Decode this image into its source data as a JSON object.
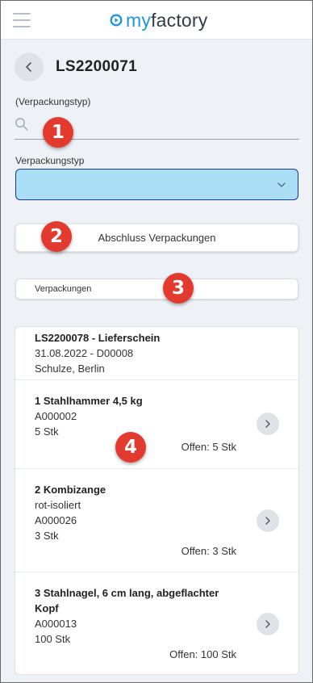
{
  "app": {
    "brand_my": "my",
    "brand_rest": "factory"
  },
  "header": {
    "document_title": "LS2200071"
  },
  "search": {
    "label": "(Verpackungstyp)",
    "value": "",
    "placeholder": ""
  },
  "packaging_type": {
    "label": "Verpackungstyp",
    "selected_value": ""
  },
  "actions": {
    "abschluss_label": "Abschluss Verpackungen",
    "verpackungen_label": "Verpackungen"
  },
  "delivery": {
    "title": "LS2200078 - Lieferschein",
    "date_line": "31.08.2022 - D00008",
    "customer": "Schulze, Berlin"
  },
  "items": [
    {
      "name": "1 Stahlhammer 4,5 kg",
      "detail": "",
      "article_no": "A000002",
      "quantity": "5 Stk",
      "open": "Offen: 5 Stk"
    },
    {
      "name": "2 Kombizange",
      "detail": "rot-isoliert",
      "article_no": "A000026",
      "quantity": "3 Stk",
      "open": "Offen: 3 Stk"
    },
    {
      "name_line1": "3 Stahlnagel, 6 cm lang, abgeflachter",
      "name_line2": "Kopf",
      "article_no": "A000013",
      "quantity": "100 Stk",
      "open": "Offen: 100 Stk"
    }
  ],
  "annotations": {
    "m1": "1",
    "m2": "2",
    "m3": "3",
    "m4": "4"
  },
  "colors": {
    "select_bg": "#a9def4",
    "select_border": "#173a9c",
    "marker": "#e23a2e",
    "brand_blue": "#1e97d6"
  },
  "icons": {
    "menu": "hamburger-icon",
    "logo": "play-circle-icon",
    "back": "chevron-left-icon",
    "search": "search-icon",
    "select": "chevron-down-icon",
    "item_open": "chevron-right-icon"
  }
}
